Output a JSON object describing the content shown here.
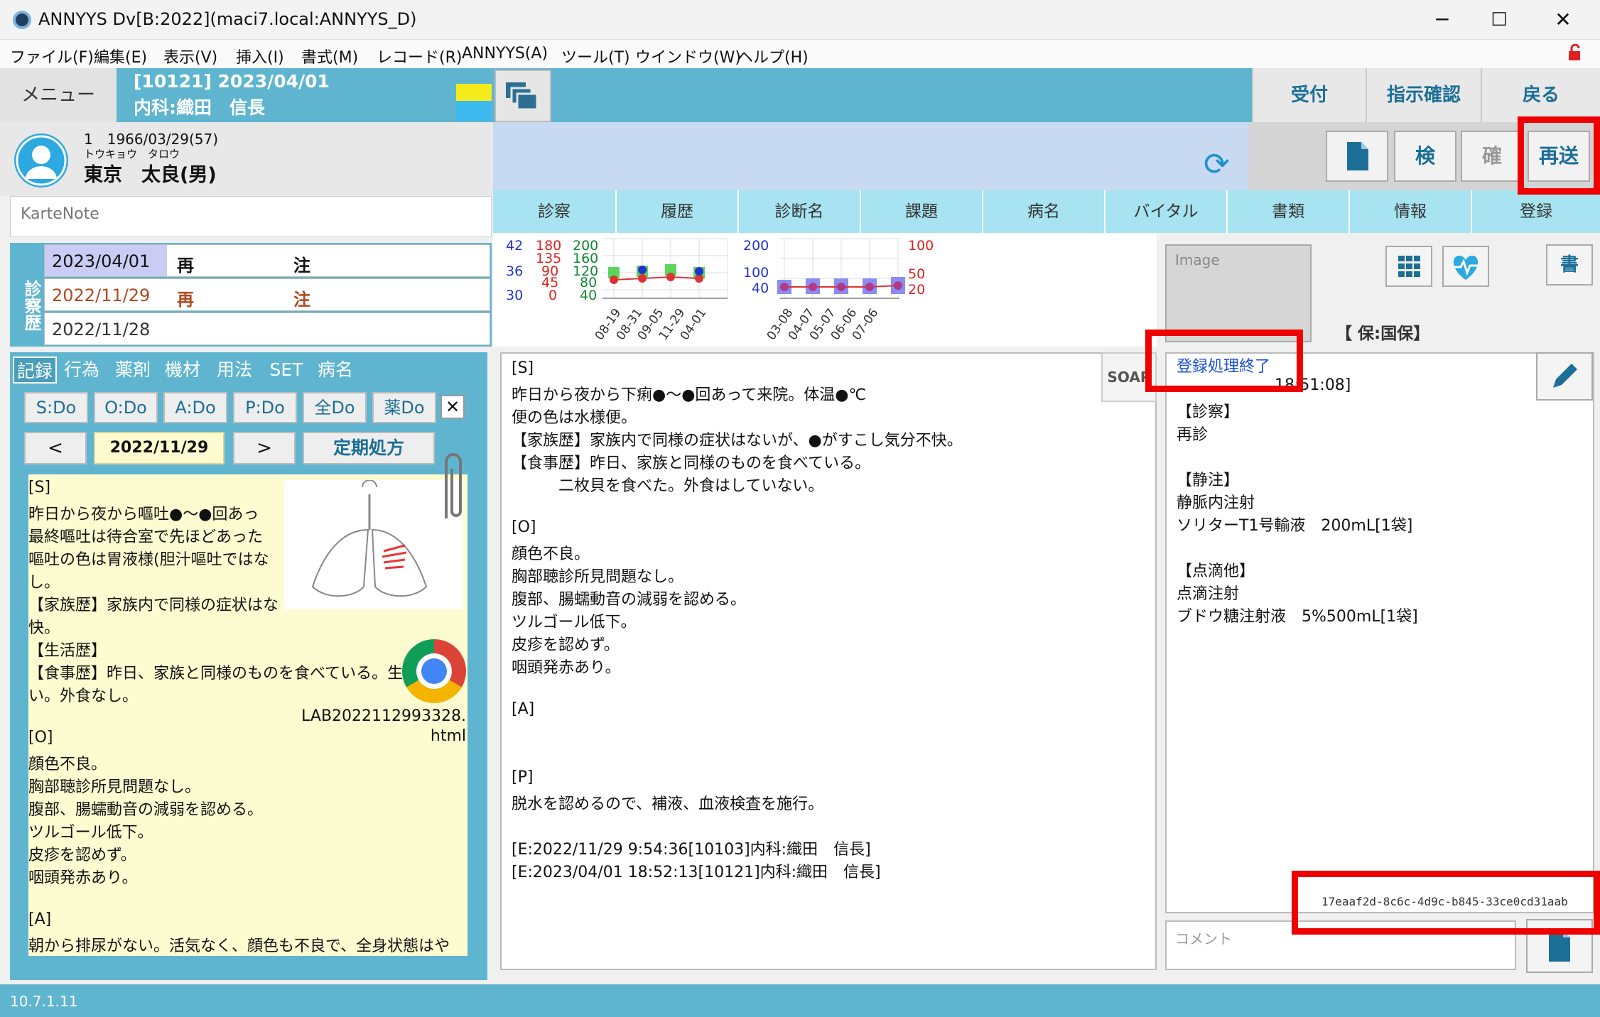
{
  "window": {
    "title": "ANNYYS Dv[B:2022](maci7.local:ANNYYS_D)",
    "minimize": "─",
    "maximize": "☐",
    "close": "✕"
  },
  "menubar": [
    "ファイル(F)",
    "編集(E)",
    "表示(V)",
    "挿入(I)",
    "書式(M)",
    "レコード(R)",
    "ANNYYS(A)",
    "ツール(T)",
    "ウインドウ(W)",
    "ヘルプ(H)"
  ],
  "header": {
    "menu_label": "メニュー",
    "doctor_line1": "[10121] 2023/04/01",
    "doctor_line2": "内科:織田　信長",
    "reception": "受付",
    "instruction_confirm": "指示確認",
    "back": "戻る"
  },
  "patient": {
    "line1": "1　1966/03/29(57)",
    "kana": "トウキョウ　タロウ",
    "name": "東京　太良(男)"
  },
  "tools": {
    "inspect": "検",
    "confirm": "確",
    "resend": "再送"
  },
  "karte_note_placeholder": "KarteNote",
  "tabs": [
    "診察",
    "履歴",
    "診断名",
    "課題",
    "病名",
    "バイタル",
    "書類",
    "情報",
    "登録"
  ],
  "history": {
    "label": "診察歴",
    "rows": [
      {
        "date": "2023/04/01",
        "type": "再",
        "flag": "注"
      },
      {
        "date": "2022/11/29",
        "type": "再",
        "flag": "注"
      },
      {
        "date": "2022/11/28",
        "type": "",
        "flag": ""
      }
    ]
  },
  "left_tabs": [
    "記録",
    "行為",
    "薬剤",
    "機材",
    "用法",
    "SET",
    "病名"
  ],
  "do_buttons": [
    "S:Do",
    "O:Do",
    "A:Do",
    "P:Do",
    "全Do",
    "薬Do"
  ],
  "left_nav": {
    "prev": "<",
    "date": "2022/11/29",
    "next": ">",
    "periodic": "定期処方",
    "close": "✕"
  },
  "left_record": [
    "[S]",
    "昨日から夜から嘔吐●～●回あっ",
    "最終嘔吐は待合室で先ほどあった",
    "嘔吐の色は胃液様(胆汁嘔吐ではな",
    "し。",
    "【家族歴】家族内で同様の症状はな",
    "快。",
    "【生活歴】",
    "【食事歴】昨日、家族と同様のものを食べている。生",
    "い。外食なし。",
    "",
    "[O]",
    "顔色不良。",
    "胸部聴診所見問題なし。",
    "腹部、腸蠕動音の減弱を認める。",
    "ツルゴール低下。",
    "皮疹を認めず。",
    "咽頭発赤あり。",
    "",
    "[A]",
    "朝から排尿がない。活気なく、顔色も不良で、全身状態はや"
  ],
  "attachment": {
    "filename_line1": "LAB2022112993328.",
    "filename_line2": "html"
  },
  "vitals_chart": {
    "left_axis_blue": [
      "42",
      "36",
      "30"
    ],
    "left_axis_red": [
      "180",
      "135",
      "90",
      "45",
      "0"
    ],
    "left_axis_green": [
      "200",
      "160",
      "120",
      "80",
      "40"
    ],
    "left_dates": [
      "08-19",
      "08-31",
      "09-05",
      "11-29",
      "04-01"
    ],
    "right_axis_blue": [
      "200",
      "100",
      "40"
    ],
    "right_axis_red": [
      "100",
      "50",
      "20"
    ],
    "right_dates": [
      "03-08",
      "04-07",
      "05-07",
      "06-06",
      "07-06"
    ]
  },
  "soap": {
    "button": "SOAP",
    "lines": [
      "[S]",
      "昨日から夜から下痢●～●回あって来院。体温●℃",
      "便の色は水様便。",
      "【家族歴】家族内で同様の症状はないが、●がすこし気分不快。",
      "【食事歴】昨日、家族と同様のものを食べている。",
      "　　　二枚貝を食べた。外食はしていない。",
      "",
      "[O]",
      "顔色不良。",
      "胸部聴診所見問題なし。",
      "腹部、腸蠕動音の減弱を認める。",
      "ツルゴール低下。",
      "皮疹を認めず。",
      "咽頭発赤あり。",
      "",
      "[A]",
      "",
      "",
      "[P]",
      "脱水を認めるので、補液、血液検査を施行。",
      "",
      "[E:2022/11/29 9:54:36[10103]内科:織田　信長]",
      "[E:2023/04/01 18:52:13[10121]内科:織田　信長]"
    ]
  },
  "image_placeholder": "Image",
  "book_button": "書",
  "insurance": "【 保:国保】",
  "registration": {
    "status": "登録処理終了",
    "timestamp_tail": "18:51:08]",
    "lines": [
      "【診察】",
      "再診",
      "",
      "【静注】",
      "静脈内注射",
      "ソリターT1号輸液　200mL[1袋]",
      "",
      "【点滴他】",
      "点滴注射",
      "ブドウ糖注射液　5%500mL[1袋]"
    ],
    "uuid": "17eaaf2d-8c6c-4d9c-b845-33ce0cd31aab"
  },
  "comment_placeholder": "コメント",
  "status": {
    "version": "10.7.1.11"
  },
  "colors": {
    "accent": "#5fb5cf",
    "tab": "#a7e3f0",
    "highlight": "#ee0000",
    "note": "#fdfbd0"
  }
}
